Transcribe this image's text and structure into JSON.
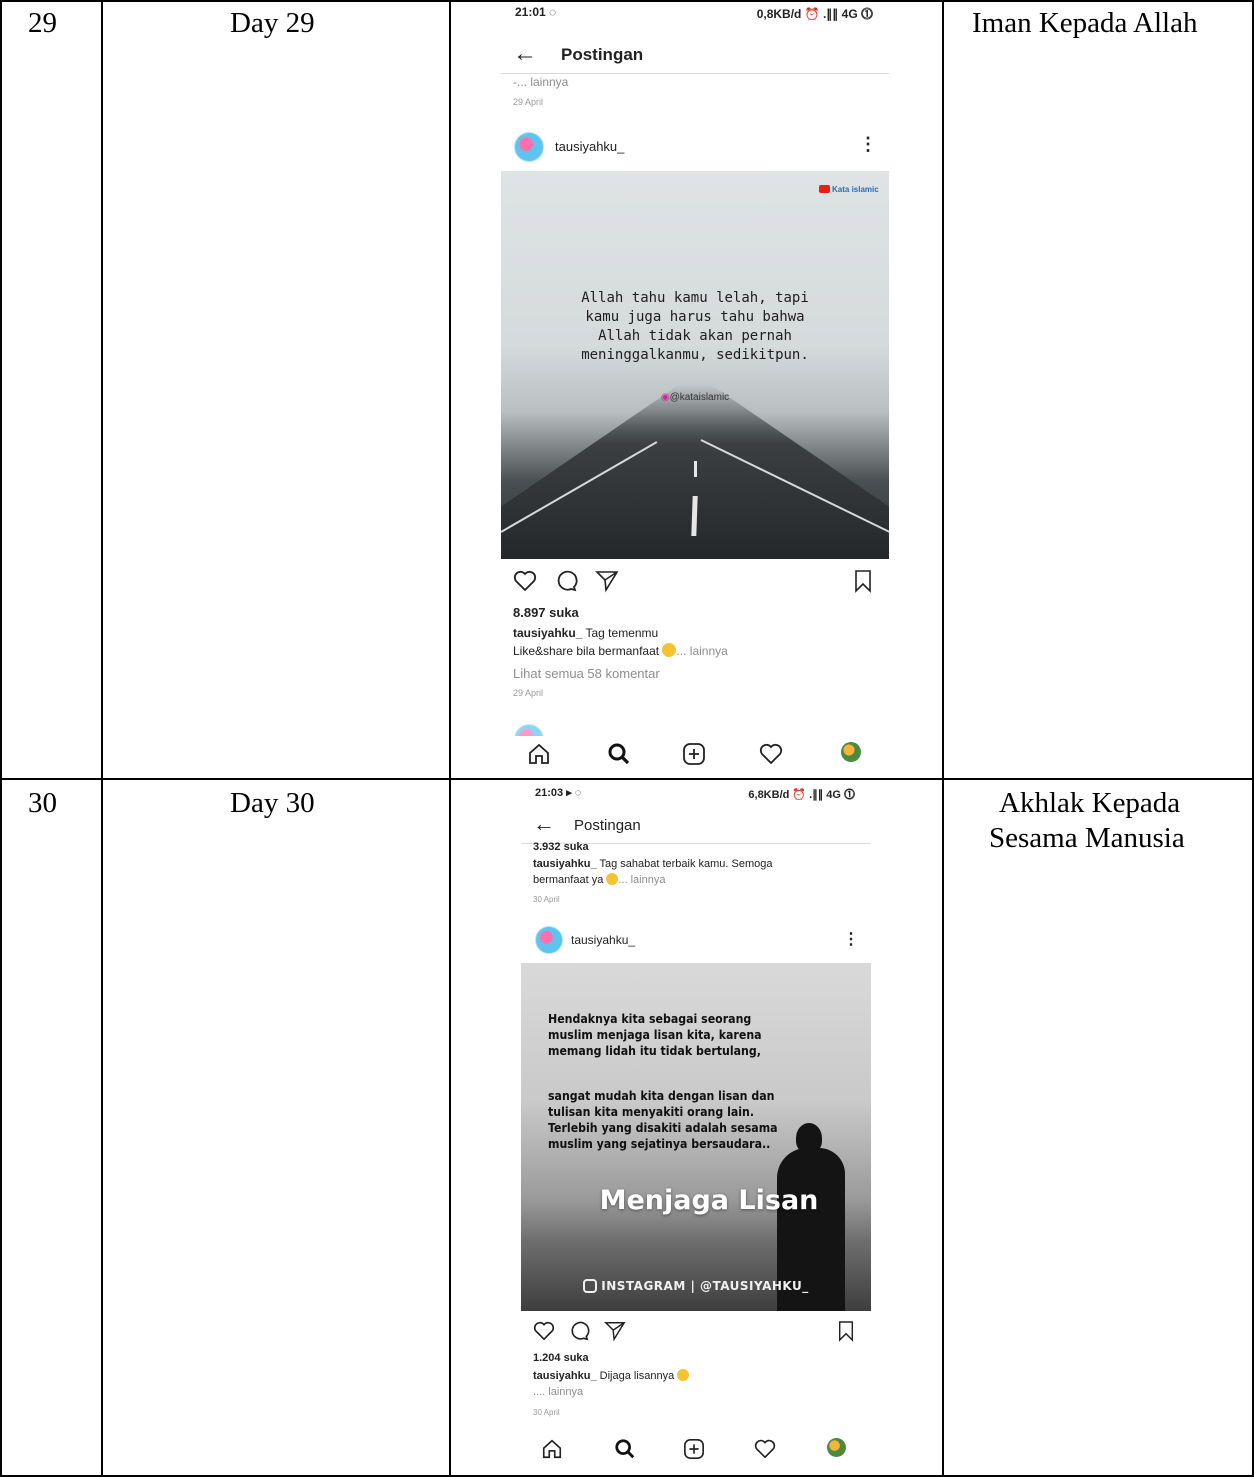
{
  "rows": [
    {
      "number": "29",
      "day": "Day 29",
      "topic": "Iman Kepada Allah",
      "phone": {
        "status_time": "21:01 ◌",
        "status_right": "0,8KB/d ⏰ .∥∥ 4G ⓵",
        "appbar_title": "Postingan",
        "prev_caption_tail": "-... lainnya",
        "prev_date": "29 April",
        "username": "tausiyahku_",
        "image_badge": "Kata islamic",
        "image_quote": [
          "Allah tahu kamu lelah, tapi",
          "kamu juga harus tahu bahwa",
          "Allah tidak akan pernah",
          "meninggalkanmu, sedikitpun."
        ],
        "image_tag": "@kataislamic",
        "likes": "8.897 suka",
        "caption_user": "tausiyahku_",
        "caption_text": "Tag temenmu",
        "caption_line2": "Like&share bila bermanfaat",
        "caption_more": "... lainnya",
        "comments_link": "Lihat semua 58 komentar",
        "date": "29 April"
      }
    },
    {
      "number": "30",
      "day": "Day 30",
      "topic_line1": "Akhlak Kepada",
      "topic_line2": "Sesama Manusia",
      "phone": {
        "status_time": "21:03 ▸ ◌",
        "status_right": "6,8KB/d ⏰ .∥∥ 4G ⓵",
        "appbar_title": "Postingan",
        "prev_likes": "3.932 suka",
        "prev_caption_user": "tausiyahku_",
        "prev_caption_text": "Tag sahabat terbaik kamu. Semoga",
        "prev_caption_line2": "bermanfaat ya",
        "prev_caption_more": "... lainnya",
        "prev_date": "30 April",
        "username": "tausiyahku_",
        "image_quote_1": [
          "Hendaknya kita sebagai seorang",
          "muslim menjaga lisan kita, karena",
          "memang lidah itu tidak bertulang,"
        ],
        "image_quote_2": [
          "sangat mudah kita dengan lisan dan",
          "tulisan kita menyakiti orang lain.",
          "Terlebih yang disakiti adalah sesama",
          "muslim yang sejatinya bersaudara.."
        ],
        "image_title": "Menjaga Lisan",
        "image_insta": "INSTAGRAM | @TAUSIYAHKU_",
        "likes": "1.204 suka",
        "caption_user": "tausiyahku_",
        "caption_text": "Dijaga lisannya",
        "caption_more": ".... lainnya",
        "date": "30 April"
      }
    }
  ],
  "icons": {
    "like": "heart-icon",
    "comment": "comment-icon",
    "share": "send-icon",
    "save": "bookmark-icon",
    "home": "home-icon",
    "search": "search-icon",
    "add": "add-post-icon",
    "activity": "heart-icon",
    "profile": "profile-avatar"
  }
}
